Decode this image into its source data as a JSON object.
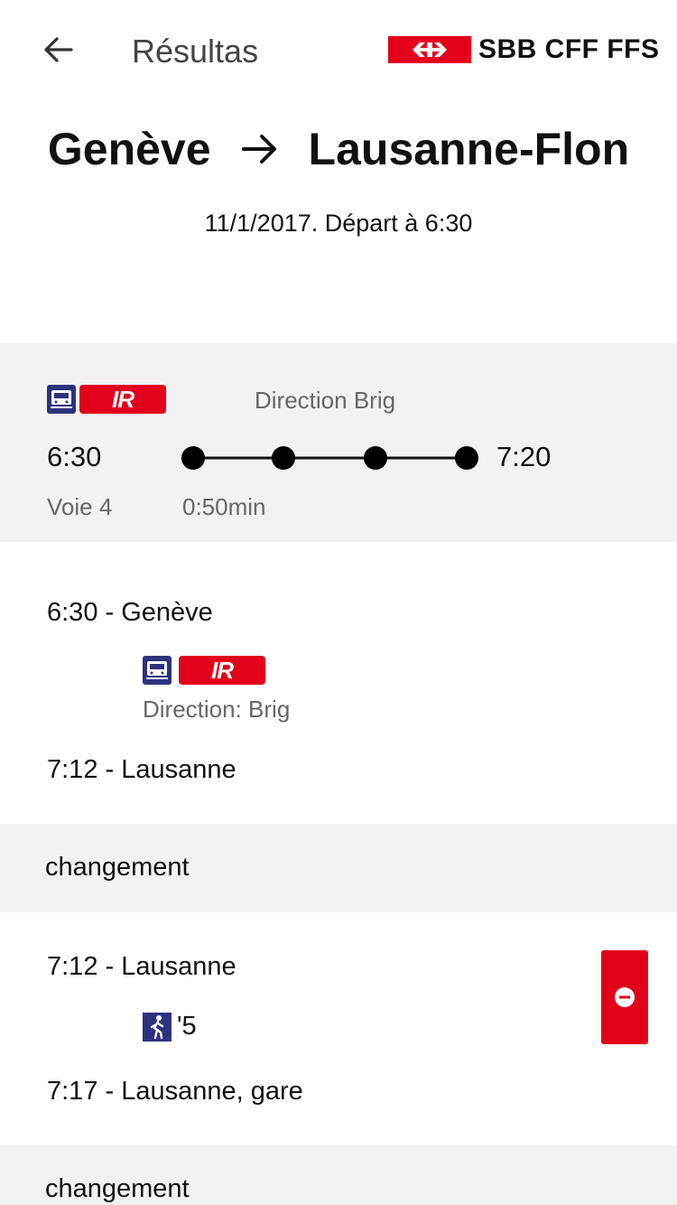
{
  "header": {
    "title": "Résultas",
    "logo_text": "SBB CFF FFS"
  },
  "route": {
    "from": "Genève",
    "to": "Lausanne-Flon",
    "date_line": "11/1/2017. Départ à 6:30"
  },
  "summary": {
    "product": "IR",
    "direction": "Direction Brig",
    "departure": "6:30",
    "arrival": "7:20",
    "track": "Voie 4",
    "duration": "0:50min"
  },
  "legs": [
    {
      "from_line": "6:30 - Genève",
      "product": "IR",
      "direction": "Direction: Brig",
      "to_line": "7:12 - Lausanne"
    },
    {
      "from_line": "7:12 - Lausanne",
      "walk": "'5",
      "to_line": "7:17 - Lausanne, gare"
    }
  ],
  "changes": [
    "changement",
    "changement"
  ],
  "colors": {
    "brand_red": "#e3001b",
    "navy": "#2d327d",
    "gray_bg": "#f2f2f2"
  },
  "icons": [
    "back-arrow-icon",
    "route-arrow-icon",
    "train-icon",
    "walk-icon",
    "minus-circle-icon",
    "swiss-cross-logo-icon"
  ]
}
